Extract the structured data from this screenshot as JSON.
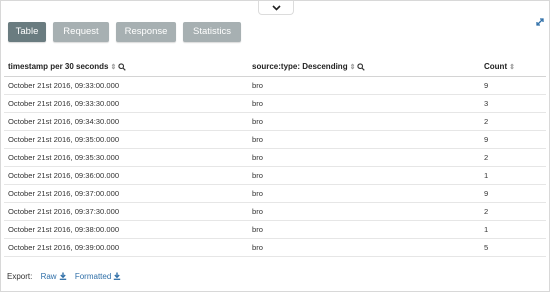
{
  "tabs": [
    {
      "label": "Table",
      "active": true
    },
    {
      "label": "Request",
      "active": false
    },
    {
      "label": "Response",
      "active": false
    },
    {
      "label": "Statistics",
      "active": false
    }
  ],
  "table": {
    "columns": [
      {
        "label": "timestamp per 30 seconds",
        "sortable": true,
        "filterable": true
      },
      {
        "label": "source:type: Descending",
        "sortable": true,
        "filterable": true
      },
      {
        "label": "Count",
        "sortable": true,
        "filterable": false
      }
    ],
    "rows": [
      [
        "October 21st 2016, 09:33:00.000",
        "bro",
        "9"
      ],
      [
        "October 21st 2016, 09:33:30.000",
        "bro",
        "3"
      ],
      [
        "October 21st 2016, 09:34:30.000",
        "bro",
        "2"
      ],
      [
        "October 21st 2016, 09:35:00.000",
        "bro",
        "9"
      ],
      [
        "October 21st 2016, 09:35:30.000",
        "bro",
        "2"
      ],
      [
        "October 21st 2016, 09:36:00.000",
        "bro",
        "1"
      ],
      [
        "October 21st 2016, 09:37:00.000",
        "bro",
        "9"
      ],
      [
        "October 21st 2016, 09:37:30.000",
        "bro",
        "2"
      ],
      [
        "October 21st 2016, 09:38:00.000",
        "bro",
        "1"
      ],
      [
        "October 21st 2016, 09:39:00.000",
        "bro",
        "5"
      ]
    ]
  },
  "export": {
    "label": "Export:",
    "raw_label": "Raw",
    "formatted_label": "Formatted"
  },
  "colors": {
    "tab_active": "#6a7c80",
    "tab_inactive": "#a7b0b2",
    "link": "#2f6fa8"
  },
  "icons": [
    "chevron-down-icon",
    "expand-icon",
    "sort-icon",
    "magnifier-icon",
    "download-icon"
  ]
}
